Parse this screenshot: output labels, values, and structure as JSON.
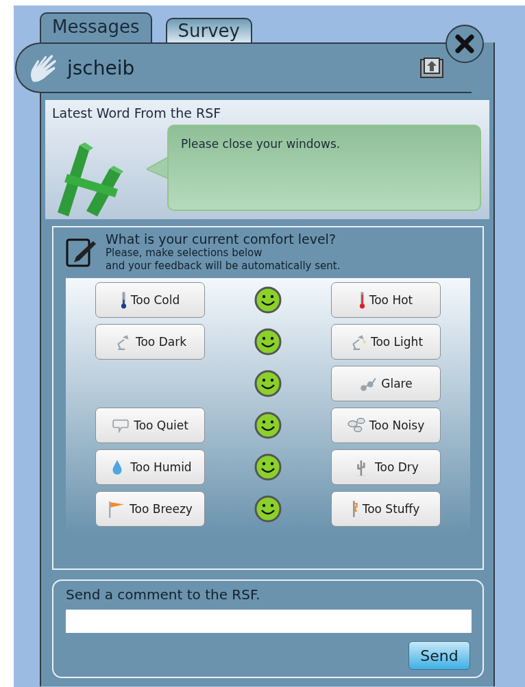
{
  "tabs": [
    {
      "label": "Messages",
      "selected": true
    },
    {
      "label": "Survey",
      "selected": false
    }
  ],
  "header": {
    "username": "jscheib"
  },
  "latest": {
    "title": "Latest Word From the RSF",
    "message": "Please close your windows."
  },
  "survey": {
    "question": "What is your current comfort level?",
    "instructions": [
      "Please, make selections below",
      "and your feedback will be automatically sent."
    ],
    "rows": [
      {
        "left": {
          "label": "Too Cold",
          "kind": "cold"
        },
        "right": {
          "label": "Too Hot",
          "kind": "hot"
        }
      },
      {
        "left": {
          "label": "Too Dark",
          "kind": "lamp"
        },
        "right": {
          "label": "Too Light",
          "kind": "lamplit"
        }
      },
      {
        "right": {
          "label": "Glare",
          "kind": "glasses"
        }
      },
      {
        "left": {
          "label": "Too Quiet",
          "kind": "bubble"
        },
        "right": {
          "label": "Too Noisy",
          "kind": "bubbles"
        }
      },
      {
        "left": {
          "label": "Too Humid",
          "kind": "drop"
        },
        "right": {
          "label": "Too Dry",
          "kind": "cactus"
        }
      },
      {
        "left": {
          "label": "Too Breezy",
          "kind": "windsock"
        },
        "right": {
          "label": "Too Stuffy",
          "kind": "stuffy"
        }
      }
    ]
  },
  "comment": {
    "label": "Send a comment to the RSF.",
    "button": "Send"
  }
}
